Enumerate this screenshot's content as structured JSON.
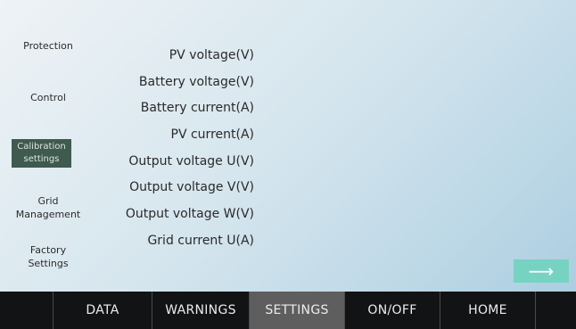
{
  "sidebar": {
    "items": [
      {
        "label": "Protection"
      },
      {
        "label": "Control"
      },
      {
        "label": "Calibration settings",
        "line1": "Calibration",
        "line2": "settings"
      },
      {
        "label": "Grid Management",
        "line1": "Grid",
        "line2": "Management"
      },
      {
        "label": "Factory Settings",
        "line1": "Factory",
        "line2": "Settings"
      }
    ],
    "active_index": 2
  },
  "parameters": [
    "PV voltage(V)",
    "Battery voltage(V)",
    "Battery current(A)",
    "PV current(A)",
    "Output voltage U(V)",
    "Output voltage V(V)",
    "Output voltage W(V)",
    "Grid current U(A)"
  ],
  "next_button": {
    "icon": "right-arrow-icon",
    "glyph": "⟶"
  },
  "tabbar": {
    "tabs": [
      "DATA",
      "WARNINGS",
      "SETTINGS",
      "ON/OFF",
      "HOME"
    ],
    "active": "SETTINGS"
  },
  "colors": {
    "active_side": "#3f5a4f",
    "next_button": "#76d3c2",
    "tabbar_bg": "#121314",
    "tab_active": "#5e5e5e"
  }
}
